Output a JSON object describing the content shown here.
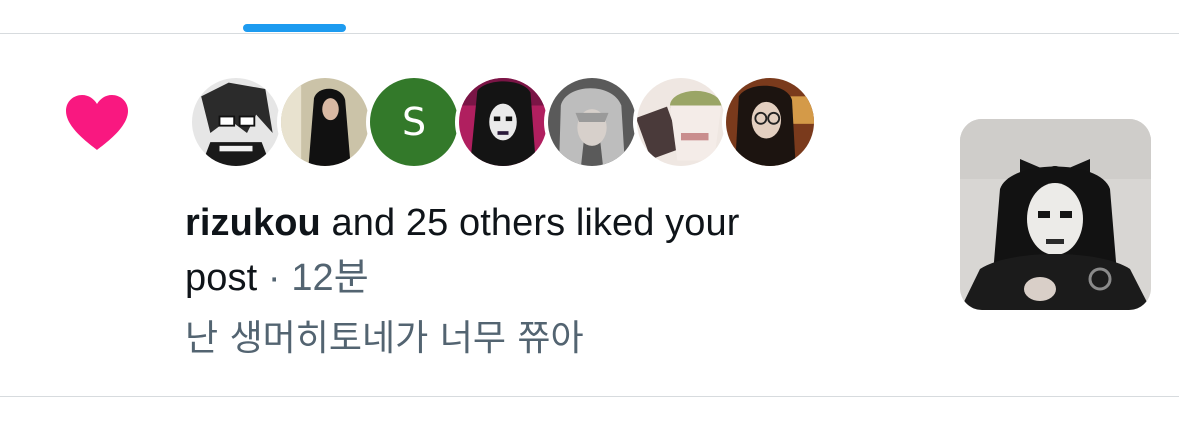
{
  "tabs": {
    "active_indicator_color": "#1d9bf0"
  },
  "notification": {
    "type_icon": "heart-icon",
    "icon_color": "#f91880",
    "avatars": [
      {
        "name": "avatar-1",
        "kind": "photo"
      },
      {
        "name": "avatar-2",
        "kind": "photo"
      },
      {
        "name": "avatar-3",
        "kind": "letter",
        "letter": "S",
        "color": "#33792a"
      },
      {
        "name": "avatar-4",
        "kind": "photo"
      },
      {
        "name": "avatar-5",
        "kind": "photo"
      },
      {
        "name": "avatar-6",
        "kind": "photo"
      },
      {
        "name": "avatar-7",
        "kind": "photo"
      }
    ],
    "username": "rizukou",
    "action_text": " and 25 others liked your",
    "action_text_line2": "post",
    "separator": " · ",
    "time": "12분",
    "post_snippet": "난 생머히토네가 너무 쮸아"
  }
}
